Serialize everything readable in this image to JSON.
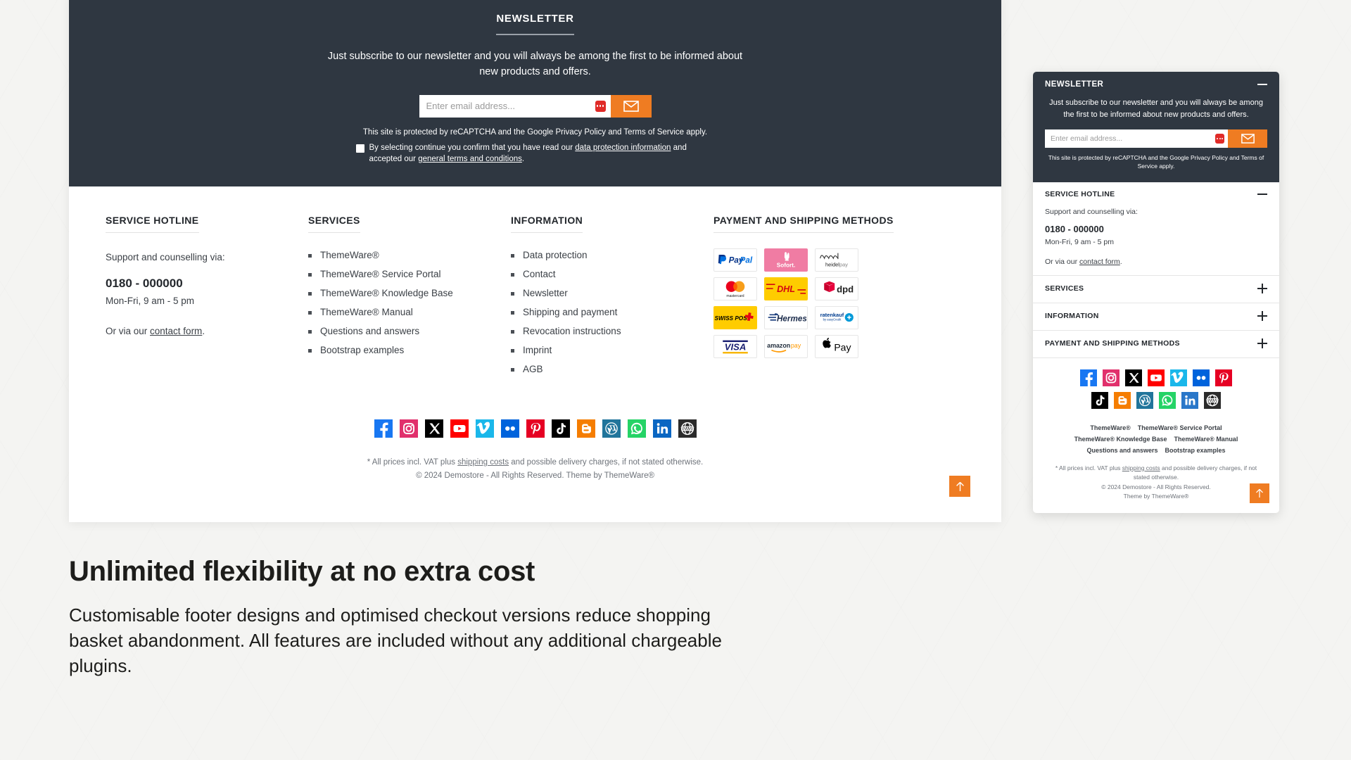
{
  "colors": {
    "dark": "#2f3741",
    "accent": "#ef7c22",
    "text": "#3a3f45",
    "muted": "#6e737a"
  },
  "newsletter": {
    "title": "NEWSLETTER",
    "subtitle": "Just subscribe to our newsletter and you will always be among the first to be informed about new products and offers.",
    "email_placeholder": "Enter email address...",
    "email_value": "",
    "submit_icon": "envelope-icon",
    "password_manager_icon": "password-manager-icon",
    "recaptcha_notice": "This site is protected by reCAPTCHA and the Google Privacy Policy and Terms of Service apply.",
    "consent_pre": "By selecting continue you confirm that you have read our ",
    "consent_link1": "data protection information",
    "consent_mid": " and accepted our ",
    "consent_link2": "general terms and conditions",
    "consent_post": "."
  },
  "columns": {
    "hotline": {
      "heading": "SERVICE HOTLINE",
      "support_label": "Support and counselling via:",
      "phone": "0180 - 000000",
      "hours": "Mon-Fri, 9 am - 5 pm",
      "contact_pre": "Or via our ",
      "contact_link": "contact form",
      "contact_post": "."
    },
    "services": {
      "heading": "SERVICES",
      "items": [
        "ThemeWare®",
        "ThemeWare® Service Portal",
        "ThemeWare® Knowledge Base",
        "ThemeWare® Manual",
        "Questions and answers",
        "Bootstrap examples"
      ]
    },
    "information": {
      "heading": "INFORMATION",
      "items": [
        "Data protection",
        "Contact",
        "Newsletter",
        "Shipping and payment",
        "Revocation instructions",
        "Imprint",
        "AGB"
      ]
    },
    "payment": {
      "heading": "PAYMENT AND SHIPPING METHODS",
      "methods": [
        "paypal-logo",
        "sofort-logo",
        "heidelpay-logo",
        "mastercard-logo",
        "dhl-logo",
        "dpd-logo",
        "swiss-post-logo",
        "hermes-logo",
        "ratenkauf-logo",
        "visa-logo",
        "amazon-pay-logo",
        "apple-pay-logo"
      ]
    }
  },
  "social": [
    "facebook-icon",
    "instagram-icon",
    "x-twitter-icon",
    "youtube-icon",
    "vimeo-icon",
    "flickr-icon",
    "pinterest-icon",
    "tiktok-icon",
    "blogger-icon",
    "wordpress-icon",
    "whatsapp-icon",
    "linkedin-icon",
    "www-icon"
  ],
  "legal": {
    "vat_pre": "* All prices incl. VAT plus ",
    "vat_link": "shipping costs",
    "vat_post": " and possible delivery charges, if not stated otherwise.",
    "copyright": "© 2024 Demostore - All Rights Reserved. Theme by ThemeWare®"
  },
  "scroll_top_icon": "arrow-up-icon",
  "mobile": {
    "newsletter": {
      "title": "NEWSLETTER",
      "subtitle": "Just subscribe to our newsletter and you will always be among the first to be informed about new products and offers.",
      "email_placeholder": "Enter email address...",
      "recaptcha_notice": "This site is protected by reCAPTCHA and the Google Privacy Policy and Terms of Service apply.",
      "collapse_icon": "minus-icon"
    },
    "hotline": {
      "heading": "SERVICE HOTLINE",
      "collapse_icon": "minus-icon",
      "support_label": "Support and counselling via:",
      "phone": "0180 - 000000",
      "hours": "Mon-Fri, 9 am - 5 pm",
      "contact_pre": "Or via our ",
      "contact_link": "contact form",
      "contact_post": "."
    },
    "accordions": [
      {
        "title": "SERVICES",
        "icon": "plus-icon"
      },
      {
        "title": "INFORMATION",
        "icon": "plus-icon"
      },
      {
        "title": "PAYMENT AND SHIPPING METHODS",
        "icon": "plus-icon"
      }
    ],
    "social_row1": [
      "facebook-icon",
      "instagram-icon",
      "x-twitter-icon",
      "youtube-icon",
      "vimeo-icon",
      "flickr-icon",
      "pinterest-icon"
    ],
    "social_row2": [
      "tiktok-icon",
      "blogger-icon",
      "wordpress-icon",
      "whatsapp-icon",
      "linkedin-icon",
      "www-icon"
    ],
    "links": [
      "ThemeWare®",
      "ThemeWare® Service Portal",
      "ThemeWare® Knowledge Base",
      "ThemeWare® Manual",
      "Questions and answers",
      "Bootstrap examples"
    ],
    "legal": {
      "vat_pre": "* All prices incl. VAT plus ",
      "vat_link": "shipping costs",
      "vat_post": " and possible delivery charges, if not stated otherwise.",
      "copyright_line1": "© 2024 Demostore - All Rights Reserved.",
      "copyright_line2": "Theme by ThemeWare®"
    },
    "scroll_top_icon": "arrow-up-icon"
  },
  "promo": {
    "headline": "Unlimited flexibility at no extra cost",
    "body": "Customisable footer designs and optimised checkout versions reduce shopping basket abandonment. All features are included without any additional chargeable plugins."
  }
}
